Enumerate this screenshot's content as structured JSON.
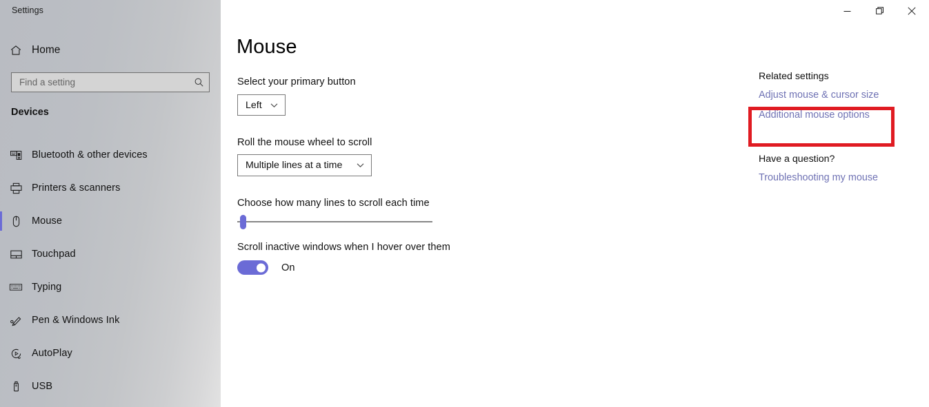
{
  "window": {
    "title": "Settings",
    "controls": {
      "minimize": "minimize-icon",
      "maximize": "restore-icon",
      "close": "close-icon"
    }
  },
  "sidebar": {
    "home_label": "Home",
    "home_icon": "home-icon",
    "search": {
      "placeholder": "Find a setting",
      "value": "",
      "icon": "search-icon"
    },
    "category_header": "Devices",
    "items": [
      {
        "label": "Bluetooth & other devices",
        "icon": "bluetooth-devices-icon",
        "selected": false
      },
      {
        "label": "Printers & scanners",
        "icon": "printer-icon",
        "selected": false
      },
      {
        "label": "Mouse",
        "icon": "mouse-icon",
        "selected": true
      },
      {
        "label": "Touchpad",
        "icon": "touchpad-icon",
        "selected": false
      },
      {
        "label": "Typing",
        "icon": "keyboard-icon",
        "selected": false
      },
      {
        "label": "Pen & Windows Ink",
        "icon": "pen-icon",
        "selected": false
      },
      {
        "label": "AutoPlay",
        "icon": "autoplay-icon",
        "selected": false
      },
      {
        "label": "USB",
        "icon": "usb-icon",
        "selected": false
      }
    ]
  },
  "main": {
    "title": "Mouse",
    "primary_button": {
      "label": "Select your primary button",
      "value": "Left",
      "chevron_icon": "chevron-down-icon"
    },
    "wheel_scroll": {
      "label": "Roll the mouse wheel to scroll",
      "value": "Multiple lines at a time",
      "chevron_icon": "chevron-down-icon"
    },
    "lines_slider": {
      "label": "Choose how many lines to scroll each time",
      "value": 1,
      "min": 1,
      "max": 100,
      "percent": 0
    },
    "inactive_scroll": {
      "label": "Scroll inactive windows when I hover over them",
      "state": "On",
      "checked": true
    }
  },
  "related": {
    "title": "Related settings",
    "links": [
      "Adjust mouse & cursor size",
      "Additional mouse options"
    ],
    "question_title": "Have a question?",
    "question_links": [
      "Troubleshooting my mouse"
    ]
  },
  "colors": {
    "accent": "#6b6bd6",
    "link": "#6f72b4",
    "highlight_border": "#e01b22"
  }
}
